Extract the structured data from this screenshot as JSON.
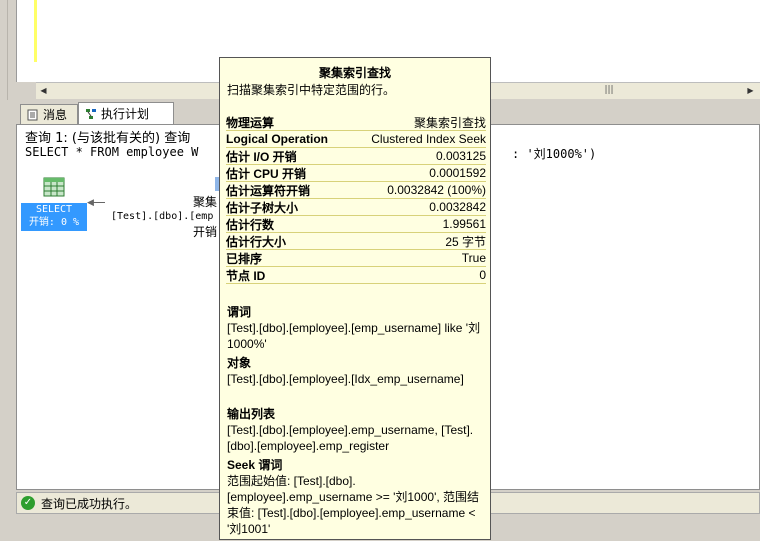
{
  "editor": {},
  "tabs": {
    "messages": "消息",
    "plan": "执行计划"
  },
  "query": {
    "header": "查询 1: (与该批有关的) 查询",
    "sql": "SELECT * FROM employee W",
    "sql_tail": ": '刘1000%')"
  },
  "plan_node": {
    "select_label": "SELECT",
    "select_cost": "开销: 0 %",
    "seek_line1": "聚集",
    "seek_line2": "[Test].[dbo].[emp",
    "seek_line3": "开销"
  },
  "status": {
    "text": "查询已成功执行。"
  },
  "tooltip": {
    "title": "聚集索引查找",
    "description": "扫描聚集索引中特定范围的行。",
    "properties": [
      {
        "key": "物理运算",
        "value": "聚集索引查找"
      },
      {
        "key": "Logical Operation",
        "value": "Clustered Index Seek"
      },
      {
        "key": "估计 I/O 开销",
        "value": "0.003125"
      },
      {
        "key": "估计 CPU 开销",
        "value": "0.0001592"
      },
      {
        "key": "估计运算符开销",
        "value": "0.0032842 (100%)"
      },
      {
        "key": "估计子树大小",
        "value": "0.0032842"
      },
      {
        "key": "估计行数",
        "value": "1.99561"
      },
      {
        "key": "估计行大小",
        "value": "25 字节"
      },
      {
        "key": "已排序",
        "value": "True"
      },
      {
        "key": "节点 ID",
        "value": "0"
      }
    ],
    "predicate_title": "谓词",
    "predicate_text": "[Test].[dbo].[employee].[emp_username] like '刘1000%'",
    "object_title": "对象",
    "object_text": "[Test].[dbo].[employee].[Idx_emp_username]",
    "output_title": "输出列表",
    "output_text": "[Test].[dbo].[employee].emp_username, [Test].[dbo].[employee].emp_register",
    "seek_title": "Seek 谓词",
    "seek_text": "范围起始值: [Test].[dbo].[employee].emp_username >= '刘1000', 范围结束值: [Test].[dbo].[employee].emp_username < '刘1001'"
  },
  "colors": {
    "tooltip_bg": "#ffffe1",
    "select_highlight": "#3399ff",
    "status_ok": "#2e9e2e"
  }
}
